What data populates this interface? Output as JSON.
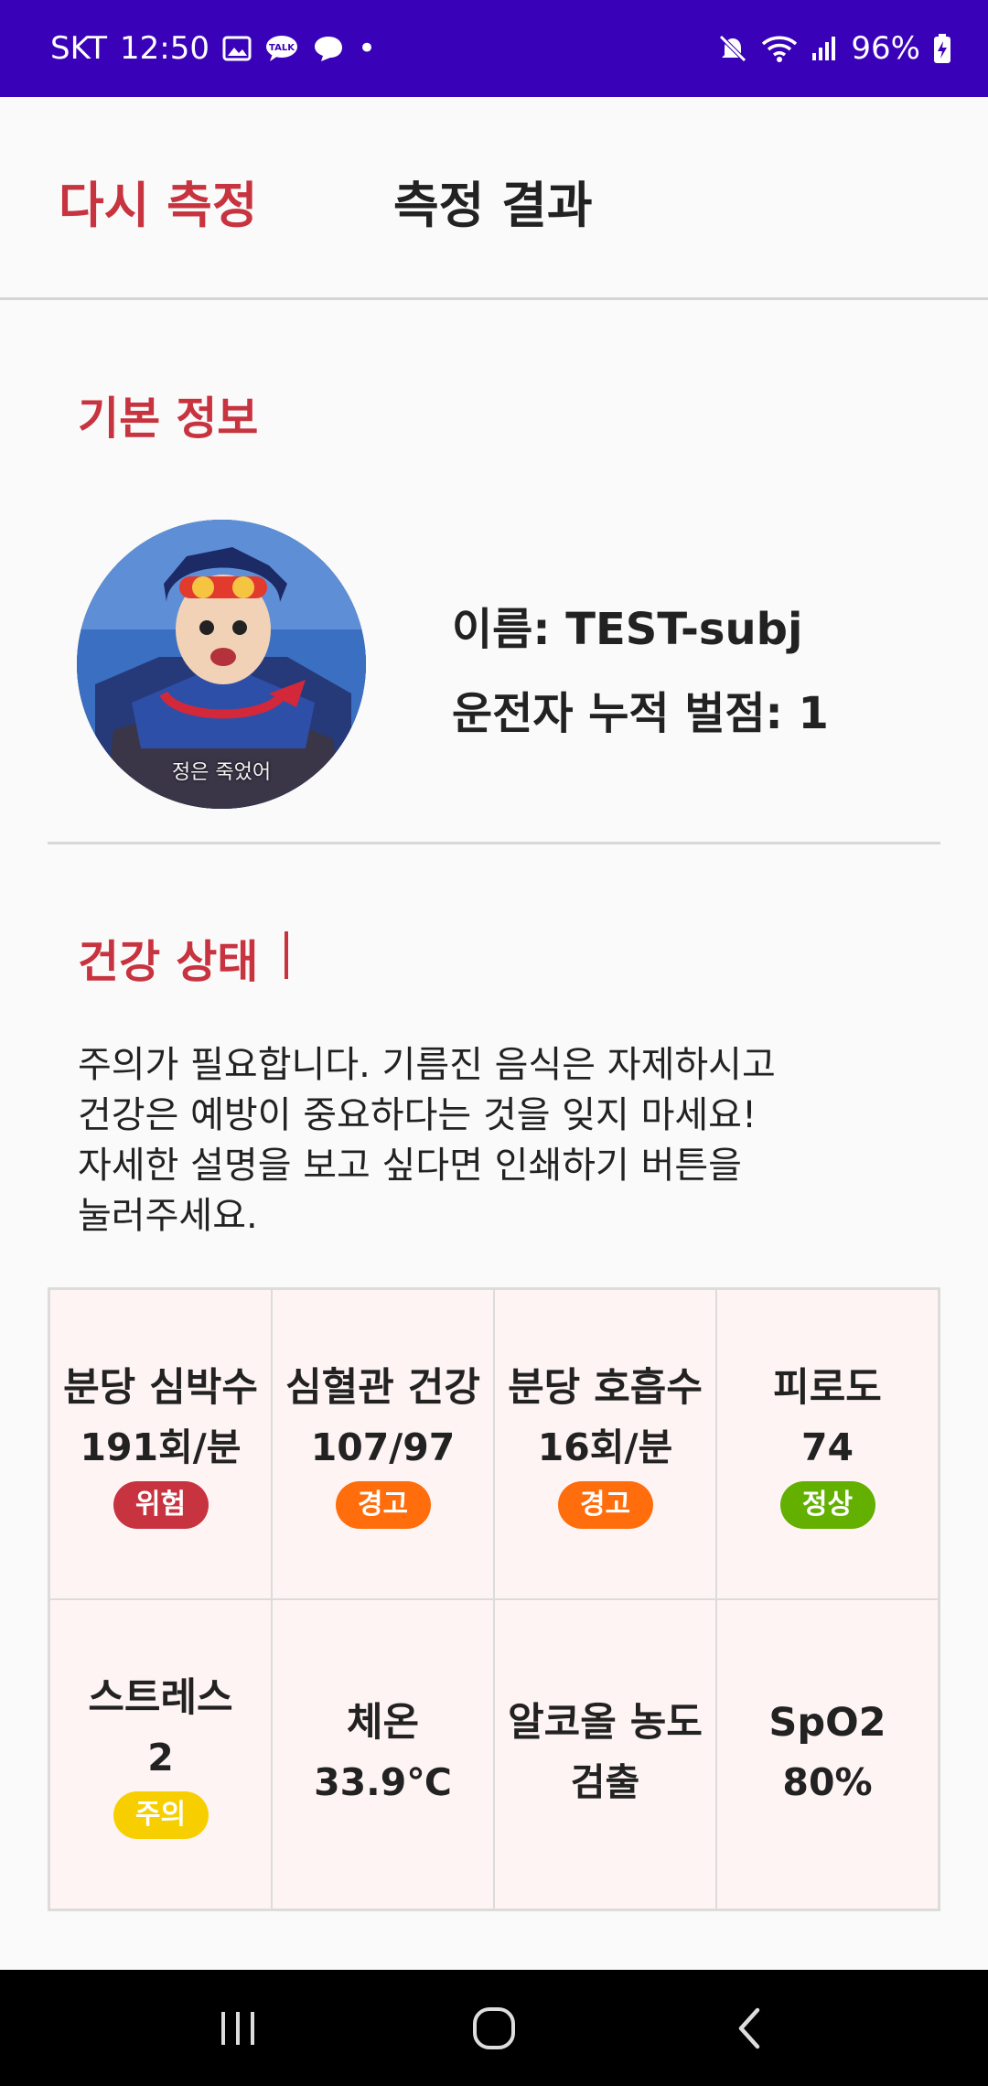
{
  "status_bar": {
    "carrier": "SKT",
    "time": "12:50",
    "dot": "•",
    "battery": "96%",
    "left_icons": [
      "gallery-icon",
      "kakaotalk-icon",
      "chat-bubble-icon"
    ],
    "right_icons": [
      "mute-icon",
      "wifi-icon",
      "signal-icon",
      "battery-charging-icon"
    ]
  },
  "header": {
    "retry_label": "다시 측정",
    "title": "측정 결과"
  },
  "basic_info": {
    "section_title": "기본 정보",
    "avatar_caption": "정은 죽었어",
    "name_line": "이름: TEST-subj",
    "penalty_line": "운전자 누적 벌점: 1"
  },
  "health": {
    "section_title": "건강 상태",
    "description_lines": [
      "주의가 필요합니다. 기름진 음식은 자제하시고",
      "건강은 예방이 중요하다는 것을 잊지 마세요!",
      "자세한 설명을 보고 싶다면 인쇄하기 버튼을",
      "눌러주세요."
    ],
    "metrics": [
      {
        "label": "분당 심박수",
        "value": "191회/분",
        "badge": "위험",
        "badge_color": "#c7333f"
      },
      {
        "label": "심혈관 건강",
        "value": "107/97",
        "badge": "경고",
        "badge_color": "#ff6d0c"
      },
      {
        "label": "분당 호흡수",
        "value": "16회/분",
        "badge": "경고",
        "badge_color": "#ff6d0c"
      },
      {
        "label": "피로도",
        "value": "74",
        "badge": "정상",
        "badge_color": "#63b000"
      },
      {
        "label": "스트레스",
        "value": "2",
        "badge": "주의",
        "badge_color": "#f7cf00"
      },
      {
        "label": "체온",
        "value": "33.9℃",
        "badge": "",
        "badge_color": ""
      },
      {
        "label": "알코올 농도",
        "value": "검출",
        "badge": "",
        "badge_color": ""
      },
      {
        "label": "SpO2",
        "value": "80%",
        "badge": "",
        "badge_color": ""
      }
    ]
  },
  "colors": {
    "status_bar": "#3a02b8",
    "accent_red": "#c7333f",
    "cell_bg": "#fff4f4"
  },
  "nav_bar": {
    "buttons": [
      "recent-apps-icon",
      "home-icon",
      "back-icon"
    ]
  }
}
